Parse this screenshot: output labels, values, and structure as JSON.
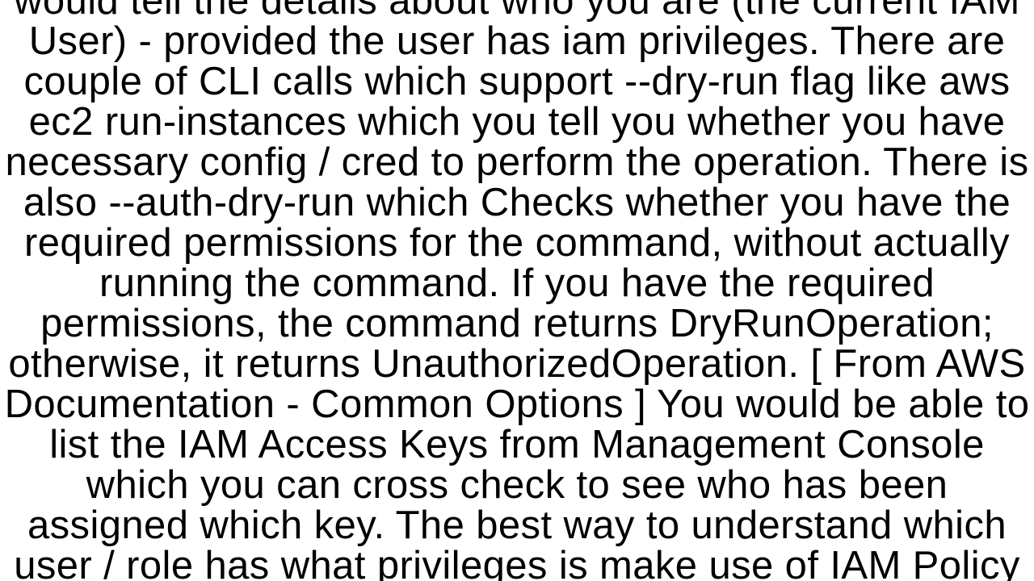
{
  "document": {
    "paragraph": "would tell the details about who you are (the current IAM User) - provided the user has iam privileges. There are couple of CLI calls which support --dry-run flag like aws ec2 run-instances which you tell you whether you have necessary config / cred to perform the operation. There is also --auth-dry-run which Checks whether you have the required permissions for the command, without actually running the command. If you have the required permissions, the command returns DryRunOperation; otherwise, it returns UnauthorizedOperation. [ From AWS Documentation - Common Options ] You would be able to list the IAM Access Keys from Management Console which you can cross check to see who has been assigned which key. The best way to understand which user / role has what privileges is make use of IAM Policy"
  }
}
